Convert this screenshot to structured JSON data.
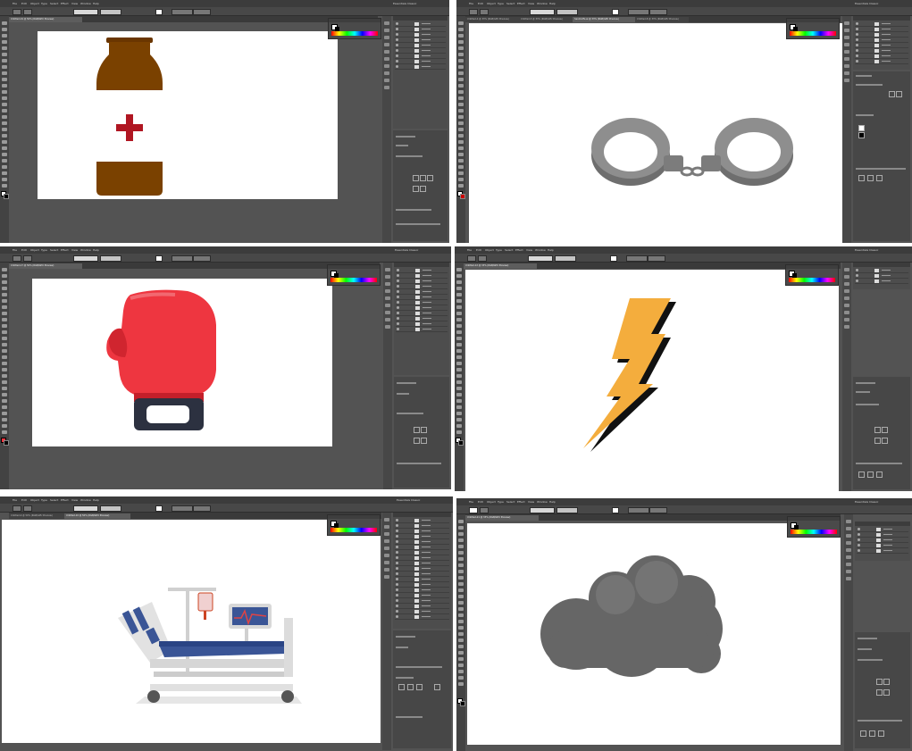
{
  "panels": [
    {
      "id": "tl",
      "menus": [
        "File",
        "Edit",
        "Object",
        "Type",
        "Select",
        "Effect",
        "View",
        "Window",
        "Help"
      ],
      "workspace": "Essentials Classic",
      "doc_tabs": [
        "Untitled-19 @ 50% (RGB/GPU Preview)"
      ],
      "artwork": "medicine-bottle",
      "layer_rows": 9
    },
    {
      "id": "tr",
      "menus": [
        "File",
        "Edit",
        "Object",
        "Type",
        "Select",
        "Effect",
        "View",
        "Window",
        "Help"
      ],
      "workspace": "Essentials Classic",
      "doc_tabs": [
        "Untitled-4 @ 33% (RGB/GPU Preview)",
        "Untitled-5 @ 33% (RGB/GPU Preview)",
        "handcuffs.ai @ 33% (RGB/GPU Preview)",
        "Untitled-8 @ 33% (RGB/GPU Preview)"
      ],
      "artwork": "handcuffs",
      "layer_rows": 8
    },
    {
      "id": "ml",
      "menus": [
        "File",
        "Edit",
        "Object",
        "Type",
        "Select",
        "Effect",
        "View",
        "Window",
        "Help"
      ],
      "workspace": "Essentials Classic",
      "doc_tabs": [
        "Untitled-17 @ 50% (RGB/GPU Preview)"
      ],
      "artwork": "boxing-glove",
      "layer_rows": 12
    },
    {
      "id": "mr",
      "menus": [
        "File",
        "Edit",
        "Object",
        "Type",
        "Select",
        "Effect",
        "View",
        "Window",
        "Help"
      ],
      "workspace": "Essentials Classic",
      "doc_tabs": [
        "Untitled-12 @ 33% (RGB/GPU Preview)"
      ],
      "artwork": "lightning-bolt",
      "layer_rows": 3
    },
    {
      "id": "bl",
      "menus": [
        "File",
        "Edit",
        "Object",
        "Type",
        "Select",
        "Effect",
        "View",
        "Window",
        "Help"
      ],
      "workspace": "Essentials Classic",
      "doc_tabs": [
        "Untitled-9 @ 50% (RGB/GPU Preview)",
        "Untitled-10 @ 50% (RGB/GPU Preview)"
      ],
      "artwork": "hospital-bed",
      "layer_rows": 19
    },
    {
      "id": "br",
      "menus": [
        "File",
        "Edit",
        "Object",
        "Type",
        "Select",
        "Effect",
        "View",
        "Window",
        "Help"
      ],
      "workspace": "Essentials Classic",
      "doc_tabs": [
        "Untitled-21 @ 33% (RGB/GPU Preview)"
      ],
      "artwork": "storm-cloud",
      "layer_rows": 5
    }
  ],
  "control_bar": {
    "stroke_label": "Stroke",
    "opacity_label": "Opacity",
    "opacity_value": "100%",
    "style_label": "Style",
    "doc_setup": "Document Setup",
    "preferences": "Preferences"
  },
  "colors": {
    "bottle_brown": "#7a4100",
    "cross_red": "#b01622",
    "glove_red": "#ee3640",
    "glove_cuff": "#2c3140",
    "bolt_orange": "#f4ad3d",
    "cuff_gray": "#8a8a8a",
    "cloud_gray": "#666666",
    "bed_blue": "#3a5596"
  }
}
